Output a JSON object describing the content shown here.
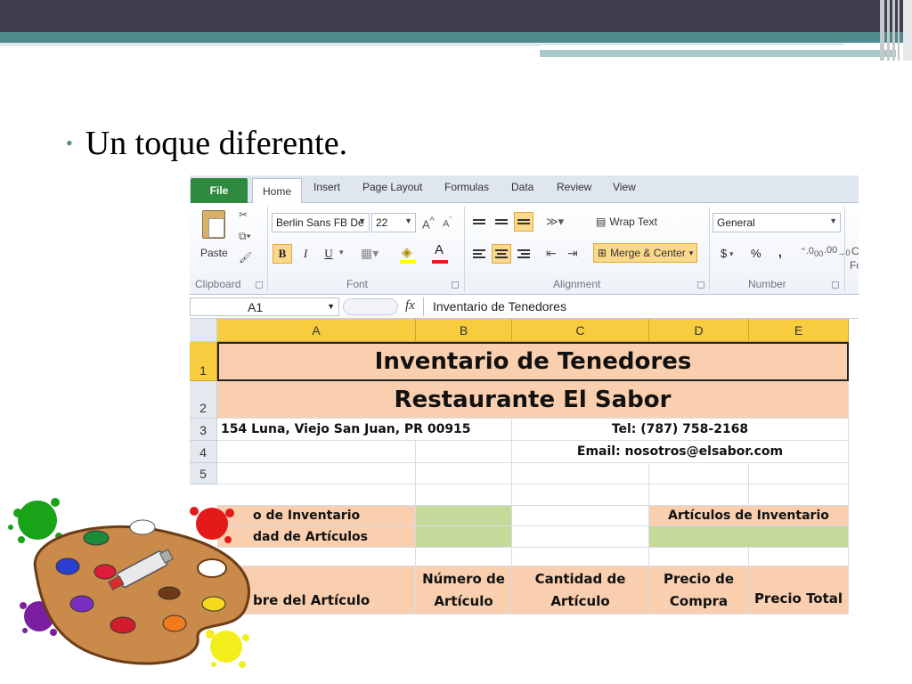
{
  "slide": {
    "bullet": "Un toque diferente."
  },
  "excel": {
    "tabs": {
      "file": "File",
      "home": "Home",
      "insert": "Insert",
      "page_layout": "Page Layout",
      "formulas": "Formulas",
      "data": "Data",
      "review": "Review",
      "view": "View"
    },
    "ribbon": {
      "paste": "Paste",
      "clipboard": "Clipboard",
      "font_name": "Berlin Sans FB De",
      "font_size": "22",
      "font_group": "Font",
      "bold": "B",
      "italic": "I",
      "underline": "U",
      "wrap_text": "Wrap Text",
      "merge_center": "Merge & Center",
      "alignment_group": "Alignment",
      "number_format": "General",
      "currency": "$",
      "percent": "%",
      "comma": ",",
      "number_group": "Number",
      "cut_off_top": "C",
      "cut_off_bottom": "Fo"
    },
    "formula_bar": {
      "name_box": "A1",
      "fx": "fx",
      "content": "Inventario de Tenedores"
    },
    "columns": [
      "A",
      "B",
      "C",
      "D",
      "E"
    ],
    "rows": [
      "1",
      "2",
      "3",
      "4",
      "5"
    ],
    "cells": {
      "title": "Inventario de Tenedores",
      "subtitle": "Restaurante El Sabor",
      "address": "154 Luna, Viejo San Juan, PR 00915",
      "tel": "Tel: (787) 758-2168",
      "email": "Email: nosotros@elsabor.com",
      "r7_a": "o de Inventario",
      "r7_d": "Artículos de Inventario",
      "r8_a": "dad de Artículos",
      "h_a": "bre del Artículo",
      "h_b": "Número de Artículo",
      "h_c": "Cantidad de Artículo",
      "h_d": "Precio de Compra",
      "h_e": "Precio Total"
    }
  },
  "colors": {
    "header_bar": "#3f3f50",
    "accent_teal": "#4f8a8c",
    "peach_fill": "#f9cfb0",
    "green_fill": "#c5d99b",
    "column_header": "#f7cd3f"
  },
  "icons": [
    "paint-palette-icon",
    "cut-icon",
    "copy-icon",
    "format-painter-icon",
    "fill-color-icon",
    "font-color-icon",
    "borders-icon"
  ]
}
